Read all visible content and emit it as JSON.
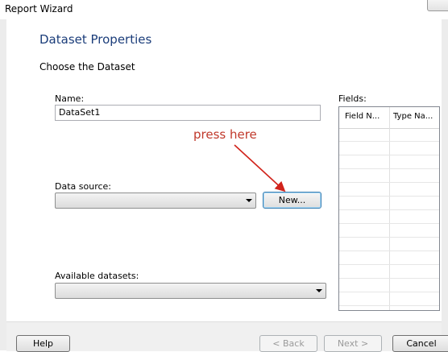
{
  "window": {
    "title": "Report Wizard"
  },
  "page": {
    "heading": "Dataset Properties",
    "subheading": "Choose the Dataset"
  },
  "form": {
    "name_label": "Name:",
    "name_value": "DataSet1",
    "data_source_label": "Data source:",
    "data_source_value": "",
    "new_button": "New...",
    "available_datasets_label": "Available datasets:",
    "available_datasets_value": ""
  },
  "fields": {
    "label": "Fields:",
    "columns": [
      "Field N...",
      "Type Na..."
    ],
    "rows": []
  },
  "annotation": {
    "text": "press here",
    "color": "#c0392b"
  },
  "footer": {
    "help": "Help",
    "back": "< Back",
    "next": "Next >",
    "cancel": "Cancel"
  },
  "colors": {
    "heading": "#1b3d7a",
    "focus_border": "#3c7fb1"
  }
}
